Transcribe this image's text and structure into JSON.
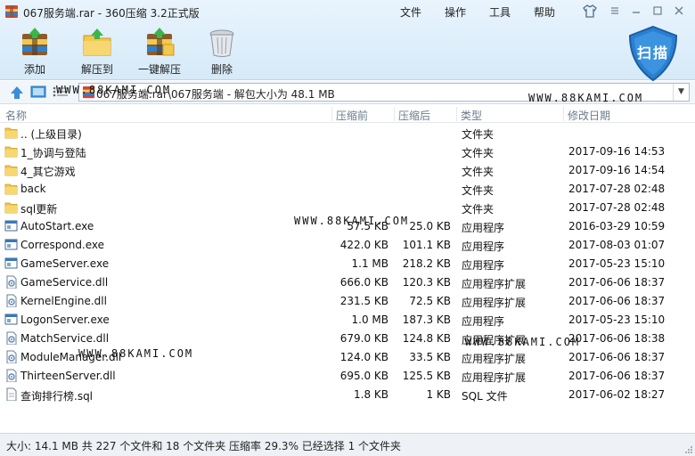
{
  "window": {
    "title": "067服务端.rar - 360压缩 3.2正式版"
  },
  "menu": {
    "file": "文件",
    "operation": "操作",
    "tools": "工具",
    "help": "帮助"
  },
  "toolbar": {
    "add": "添加",
    "extract_to": "解压到",
    "one_click_extract": "一键解压",
    "delete": "删除",
    "scan": "扫描"
  },
  "address": {
    "path": "067服务端.rar\\067服务端 - 解包大小为 48.1 MB"
  },
  "columns": {
    "name": "名称",
    "size": "压缩前",
    "packed": "压缩后",
    "type": "类型",
    "modified": "修改日期"
  },
  "files": [
    {
      "name": ".. (上级目录)",
      "size": "",
      "packed": "",
      "type": "文件夹",
      "date": "",
      "icon": "folder-icon"
    },
    {
      "name": "1_协调与登陆",
      "size": "",
      "packed": "",
      "type": "文件夹",
      "date": "2017-09-16 14:53",
      "icon": "folder-icon"
    },
    {
      "name": "4_其它游戏",
      "size": "",
      "packed": "",
      "type": "文件夹",
      "date": "2017-09-16 14:54",
      "icon": "folder-icon"
    },
    {
      "name": "back",
      "size": "",
      "packed": "",
      "type": "文件夹",
      "date": "2017-07-28 02:48",
      "icon": "folder-icon"
    },
    {
      "name": "sql更新",
      "size": "",
      "packed": "",
      "type": "文件夹",
      "date": "2017-07-28 02:48",
      "icon": "folder-icon"
    },
    {
      "name": "AutoStart.exe",
      "size": "57.5 KB",
      "packed": "25.0 KB",
      "type": "应用程序",
      "date": "2016-03-29 10:59",
      "icon": "exe-icon"
    },
    {
      "name": "Correspond.exe",
      "size": "422.0 KB",
      "packed": "101.1 KB",
      "type": "应用程序",
      "date": "2017-08-03 01:07",
      "icon": "exe-icon"
    },
    {
      "name": "GameServer.exe",
      "size": "1.1 MB",
      "packed": "218.2 KB",
      "type": "应用程序",
      "date": "2017-05-23 15:10",
      "icon": "exe-icon"
    },
    {
      "name": "GameService.dll",
      "size": "666.0 KB",
      "packed": "120.3 KB",
      "type": "应用程序扩展",
      "date": "2017-06-06 18:37",
      "icon": "dll-icon"
    },
    {
      "name": "KernelEngine.dll",
      "size": "231.5 KB",
      "packed": "72.5 KB",
      "type": "应用程序扩展",
      "date": "2017-06-06 18:37",
      "icon": "dll-icon"
    },
    {
      "name": "LogonServer.exe",
      "size": "1.0 MB",
      "packed": "187.3 KB",
      "type": "应用程序",
      "date": "2017-05-23 15:10",
      "icon": "exe-icon"
    },
    {
      "name": "MatchService.dll",
      "size": "679.0 KB",
      "packed": "124.8 KB",
      "type": "应用程序扩展",
      "date": "2017-06-06 18:38",
      "icon": "dll-icon"
    },
    {
      "name": "ModuleManager.dll",
      "size": "124.0 KB",
      "packed": "33.5 KB",
      "type": "应用程序扩展",
      "date": "2017-06-06 18:37",
      "icon": "dll-icon"
    },
    {
      "name": "ThirteenServer.dll",
      "size": "695.0 KB",
      "packed": "125.5 KB",
      "type": "应用程序扩展",
      "date": "2017-06-06 18:37",
      "icon": "dll-icon"
    },
    {
      "name": "查询排行榜.sql",
      "size": "1.8 KB",
      "packed": "1 KB",
      "type": "SQL 文件",
      "date": "2017-06-02 18:27",
      "icon": "sql-file-icon"
    }
  ],
  "watermark": "WWW.88KAMI.COM",
  "status": {
    "text": "大小: 14.1 MB 共 227 个文件和 18 个文件夹 压缩率 29.3% 已经选择 1 个文件夹"
  },
  "colors": {
    "accent": "#1f6fb8",
    "chrome": "#dcedfa",
    "folder": "#f2c94c"
  }
}
